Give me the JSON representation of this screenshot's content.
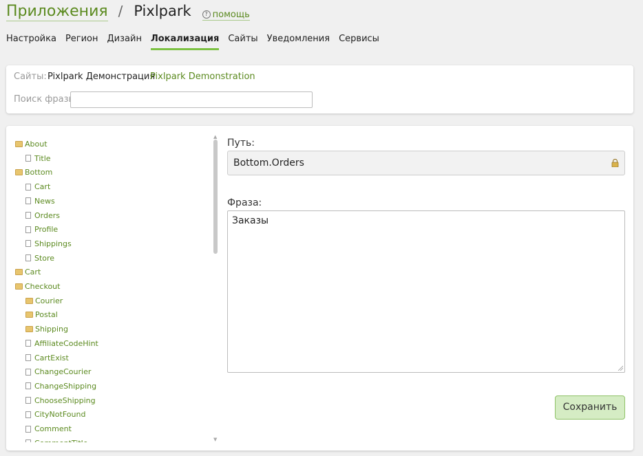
{
  "breadcrumb": {
    "apps": "Приложения",
    "separator": "/",
    "current": "Pixlpark",
    "help": "помощь",
    "help_icon": "?"
  },
  "tabs": [
    {
      "label": "Настройка"
    },
    {
      "label": "Регион"
    },
    {
      "label": "Дизайн"
    },
    {
      "label": "Локализация",
      "active": true
    },
    {
      "label": "Сайты"
    },
    {
      "label": "Уведомления"
    },
    {
      "label": "Сервисы"
    }
  ],
  "sites": {
    "label": "Сайты:",
    "items": [
      "Pixlpark Демонстрация",
      "Pixlpark Demonstration"
    ]
  },
  "search": {
    "label": "Поиск фразы",
    "value": "",
    "placeholder": ""
  },
  "tree": [
    {
      "label": "About",
      "type": "folder",
      "level": 0
    },
    {
      "label": "Title",
      "type": "page",
      "level": 1
    },
    {
      "label": "Bottom",
      "type": "folder",
      "level": 0
    },
    {
      "label": "Cart",
      "type": "page",
      "level": 1
    },
    {
      "label": "News",
      "type": "page",
      "level": 1
    },
    {
      "label": "Orders",
      "type": "page",
      "level": 1
    },
    {
      "label": "Profile",
      "type": "page",
      "level": 1
    },
    {
      "label": "Shippings",
      "type": "page",
      "level": 1
    },
    {
      "label": "Store",
      "type": "page",
      "level": 1
    },
    {
      "label": "Cart",
      "type": "folder",
      "level": 0
    },
    {
      "label": "Checkout",
      "type": "folder",
      "level": 0
    },
    {
      "label": "Courier",
      "type": "folder",
      "level": 1
    },
    {
      "label": "Postal",
      "type": "folder",
      "level": 1
    },
    {
      "label": "Shipping",
      "type": "folder",
      "level": 1
    },
    {
      "label": "AffiliateCodeHint",
      "type": "page",
      "level": 1
    },
    {
      "label": "CartExist",
      "type": "page",
      "level": 1
    },
    {
      "label": "ChangeCourier",
      "type": "page",
      "level": 1
    },
    {
      "label": "ChangeShipping",
      "type": "page",
      "level": 1
    },
    {
      "label": "ChooseShipping",
      "type": "page",
      "level": 1
    },
    {
      "label": "CityNotFound",
      "type": "page",
      "level": 1
    },
    {
      "label": "Comment",
      "type": "page",
      "level": 1
    },
    {
      "label": "CommentTitle",
      "type": "page",
      "level": 1
    }
  ],
  "editor": {
    "path_label": "Путь:",
    "path_value": "Bottom.Orders",
    "phrase_label": "Фраза:",
    "phrase_value": "Заказы",
    "save_label": "Сохранить"
  },
  "colors": {
    "accent": "#5b8a1f",
    "tab_underline": "#7cc142",
    "button_bg": "#d5ecc4"
  }
}
